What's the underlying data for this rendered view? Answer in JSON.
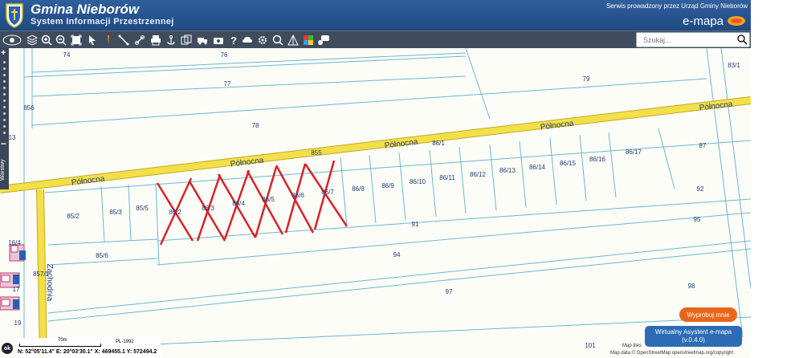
{
  "header": {
    "title": "Gmina Nieborów",
    "subtitle": "System Informacji Przestrzennej",
    "service_note": "Serwis prowadzony przez Urząd Gminy Nieborów",
    "brand": "e-mapa"
  },
  "toolbar": {
    "search_placeholder": "Szukaj...",
    "tools": [
      "map-mode-icon",
      "layers-icon",
      "zoom-in-icon",
      "zoom-out-icon",
      "full-extent-icon",
      "select-arrow-icon",
      "pencil-icon",
      "measure-line-icon",
      "link-icon",
      "print-icon",
      "anchor-icon",
      "export-icon",
      "truck-icon",
      "camera-icon",
      "help-icon",
      "cloud-icon",
      "settings-icon",
      "zoom-tool-icon",
      "distance-icon",
      "color-icon",
      "comment-icon"
    ]
  },
  "sidebar": {
    "layers_label": "Warstwy"
  },
  "map": {
    "streets": [
      {
        "name": "Północna"
      },
      {
        "name": "Północna"
      },
      {
        "name": "Północna"
      },
      {
        "name": "Północna"
      },
      {
        "name": "Zachodnia"
      }
    ],
    "parcels": [
      "74",
      "76",
      "77",
      "78",
      "79",
      "83/1",
      "856",
      "13",
      "855",
      "86/1",
      "87",
      "85/2",
      "85/3",
      "85/5",
      "86/2",
      "86/3",
      "86/4",
      "86/5",
      "86/6",
      "86/7",
      "86/8",
      "86/9",
      "86/10",
      "86/11",
      "86/12",
      "86/13",
      "86/14",
      "86/15",
      "86/16",
      "86/17",
      "92",
      "91",
      "95",
      "85/6",
      "94",
      "857/1",
      "97",
      "98",
      "101",
      "16/4",
      "17",
      "19"
    ],
    "accent": "#d6232a",
    "road_color": "#f2e04a"
  },
  "status": {
    "scale_label": "70m",
    "crs": "PL-1992",
    "coords": "N: 52°05'11.4\"  E: 20°03'30.1\"  X: 469455.1   Y: 572494.2",
    "ok": "ok"
  },
  "assistant": {
    "try_label": "Wypróbuj mnie",
    "title": "Wirtualny Asystent e-mapa",
    "version": "(v.0.4.0)"
  },
  "attribution": {
    "tiles": "Map tiles",
    "data": "Map data © OpenStreetMap openstreetmap.org/copyright"
  }
}
